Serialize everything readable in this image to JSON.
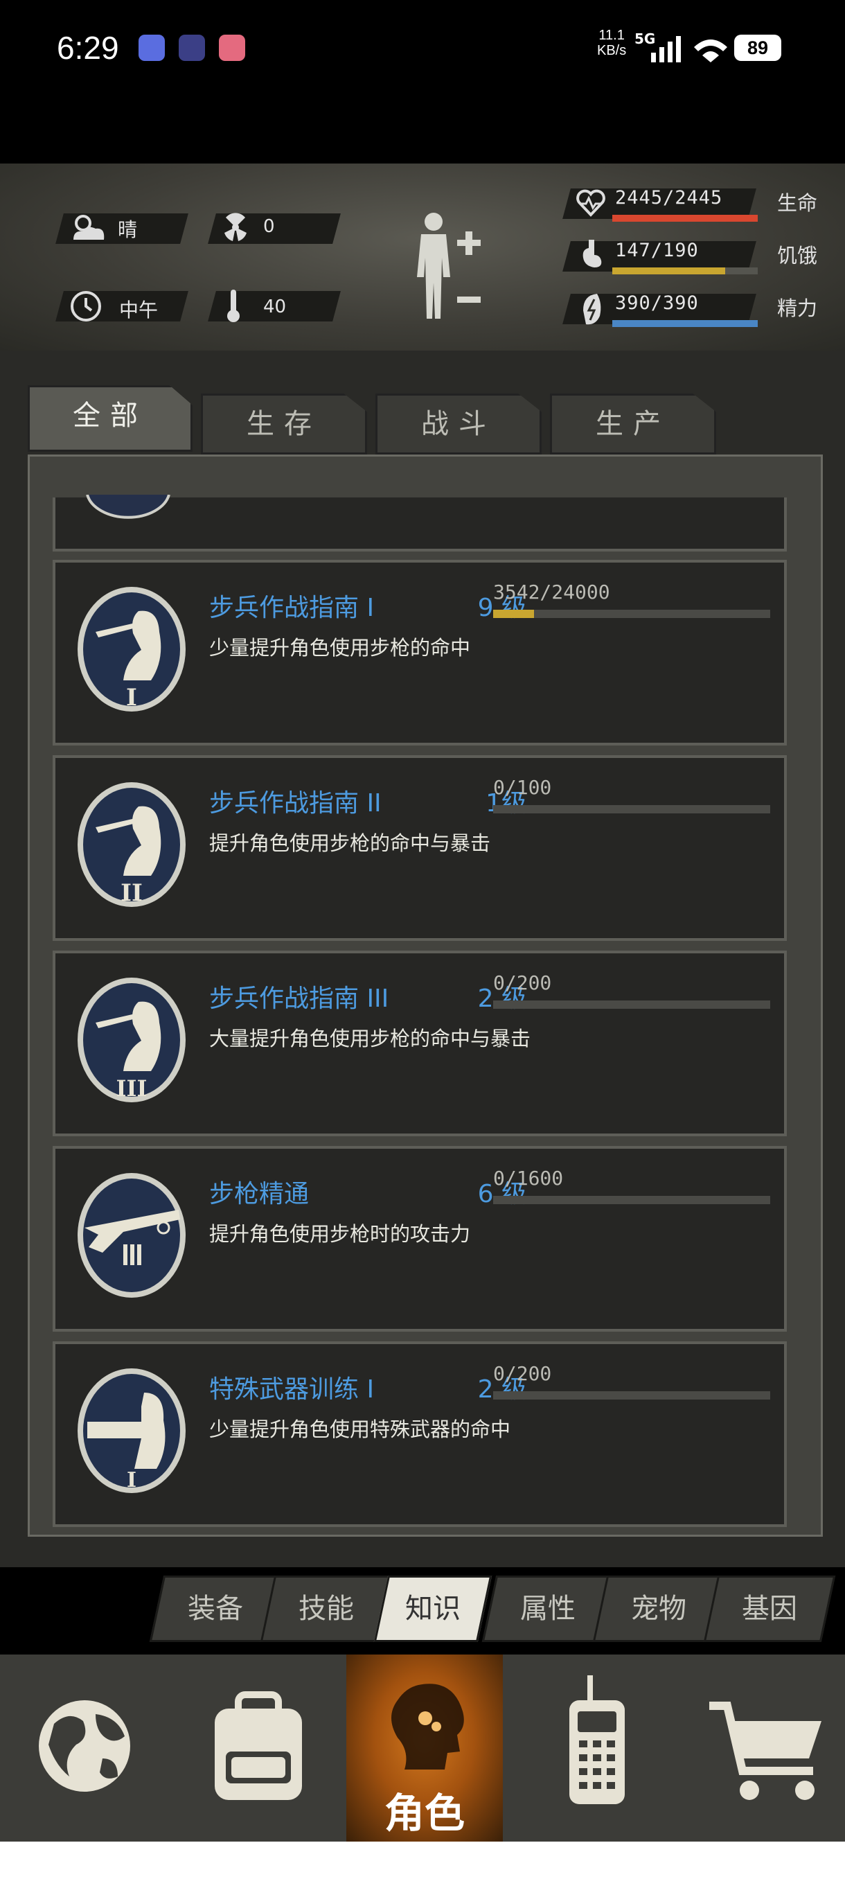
{
  "status_bar": {
    "time": "6:29",
    "net_speed": "11.1",
    "net_unit": "KB/s",
    "network": "5G",
    "battery": "89"
  },
  "header": {
    "weather": "晴",
    "radiation": "0",
    "time_of_day": "中午",
    "temperature": "40",
    "stats": [
      {
        "name": "生命",
        "value": "2445/2445",
        "fraction": 1.0,
        "color": "#d9472f",
        "icon": "heart-icon"
      },
      {
        "name": "饥饿",
        "value": "147/190",
        "fraction": 0.774,
        "color": "#c9a630",
        "icon": "stomach-icon"
      },
      {
        "name": "精力",
        "value": "390/390",
        "fraction": 1.0,
        "color": "#4a86c5",
        "icon": "energy-icon"
      }
    ]
  },
  "tabs": [
    "全部",
    "生存",
    "战斗",
    "生产"
  ],
  "active_tab": "全部",
  "skills": [
    {
      "title": "步兵作战指南 I",
      "level": "9 级",
      "progress": "3542/24000",
      "fraction": 0.1476,
      "desc": "少量提升角色使用步枪的命中",
      "icon": "rifleman-icon",
      "badge": "I"
    },
    {
      "title": "步兵作战指南 II",
      "level": "1级",
      "progress": "0/100",
      "fraction": 0,
      "desc": "提升角色使用步枪的命中与暴击",
      "icon": "rifleman-icon",
      "badge": "II"
    },
    {
      "title": "步兵作战指南 III",
      "level": "2 级",
      "progress": "0/200",
      "fraction": 0,
      "desc": "大量提升角色使用步枪的命中与暴击",
      "icon": "rifleman-icon",
      "badge": "III"
    },
    {
      "title": "步枪精通",
      "level": "6 级",
      "progress": "0/1600",
      "fraction": 0,
      "desc": "提升角色使用步枪时的攻击力",
      "icon": "rifle-icon",
      "badge": ""
    },
    {
      "title": "特殊武器训练 I",
      "level": "2 级",
      "progress": "0/200",
      "fraction": 0,
      "desc": "少量提升角色使用特殊武器的命中",
      "icon": "minigun-icon",
      "badge": "I"
    }
  ],
  "sub_tabs": [
    "装备",
    "技能",
    "知识",
    "属性",
    "宠物",
    "基因"
  ],
  "active_sub_tab": "知识",
  "nav": {
    "items": [
      "globe-icon",
      "backpack-icon",
      "character-icon",
      "radio-icon",
      "cart-icon"
    ],
    "active_label": "角色"
  }
}
